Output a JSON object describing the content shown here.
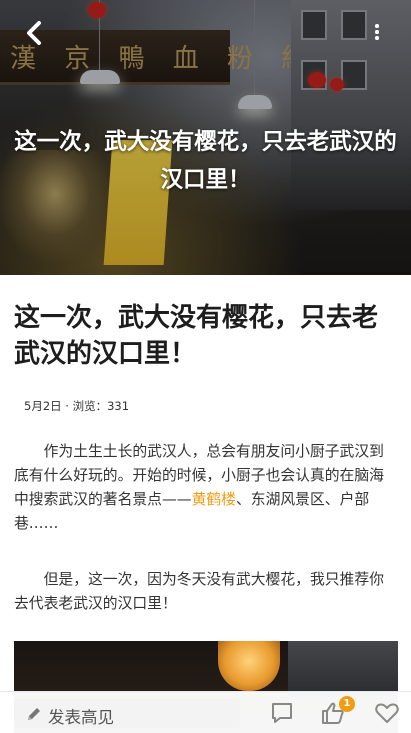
{
  "hero": {
    "title": "这一次，武大没有樱花，只去老武汉的汉口里！",
    "back_icon": "chevron-left-icon",
    "more_icon": "more-vertical-icon"
  },
  "article": {
    "title": "这一次，武大没有樱花，只去老武汉的汉口里！",
    "meta": "5月2日 · 浏览：331",
    "para1_before": "作为土生土长的武汉人，总会有朋友问小厨子武汉到底有什么好玩的。开始的时候，小厨子也会认真的在脑海中搜索武汉的著名景点——",
    "para1_highlight": "黄鹤楼",
    "para1_after": "、东湖风景区、户部巷……",
    "para2": "但是，这一次，因为冬天没有武大樱花，我只推荐你去代表老武汉的汉口里！"
  },
  "bottom_bar": {
    "comment_placeholder": "发表高见",
    "like_count": "1",
    "icons": [
      "pencil-icon",
      "comment-icon",
      "thumbs-up-icon",
      "heart-icon"
    ]
  },
  "colors": {
    "accent": "#f39c12",
    "text": "#333333"
  }
}
